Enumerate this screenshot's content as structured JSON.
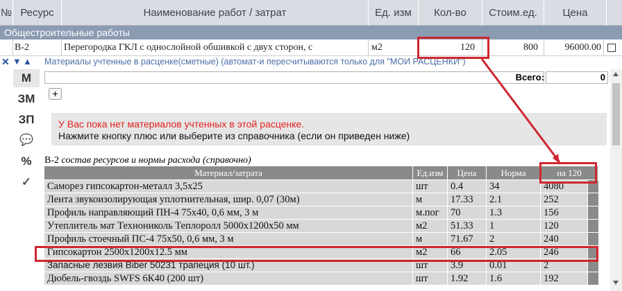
{
  "header": {
    "num": "№",
    "resource": "Ресурс",
    "name": "Наименование работ / затрат",
    "unit": "Ед. изм",
    "qty": "Кол-во",
    "unit_price": "Стоим.ед.",
    "price": "Цена"
  },
  "category": "Общестроительные работы",
  "work_row": {
    "resource": "В-2",
    "name": "Перегородка ГКЛ с однослойной обшивкой с двух сторон, с",
    "unit": "м2",
    "qty": "120",
    "unit_price": "800",
    "price": "96000.00"
  },
  "materials_bar": {
    "close": "✕",
    "down": "▼",
    "up": "▲",
    "text": "Материалы учтенные в расценке(сметные) (автомат-и пересчитываются только для \"МОИ РАСЦЕНКИ\")"
  },
  "sidebar": {
    "m": "М",
    "zm": "ЗМ",
    "zp": "ЗП",
    "comment_icon": "💬",
    "percent": "%",
    "check": "✓"
  },
  "totals": {
    "label": "Всего:",
    "value": "0"
  },
  "add_button": "+",
  "notice": {
    "red_line": "У Вас пока нет материалов учтенных в этой расценке.",
    "black_line": "Нажмите кнопку плюс или выберите из справочника (если он приведен ниже)"
  },
  "reference": {
    "code": "В-2",
    "title": "состав ресурсов и нормы расхода (справочно)",
    "columns": [
      "Материал/затрата",
      "Ед.изм",
      "Цена",
      "Норма",
      "на 120"
    ],
    "rows": [
      [
        "Саморез гипсокартон-металл 3,5х25",
        "шт",
        "0.4",
        "34",
        "4080"
      ],
      [
        "Лента звукоизолирующая уплотнительная, шир. 0,07 (30м)",
        "м",
        "17.33",
        "2.1",
        "252"
      ],
      [
        "Профиль направляющий ПН-4 75х40, 0,6 мм, 3 м",
        "м.пог",
        "70",
        "1.3",
        "156"
      ],
      [
        "Утеплитель мат Технониколь Теплоролл 5000х1200х50 мм",
        "м2",
        "51.33",
        "1",
        "120"
      ],
      [
        "Профиль стоечный ПС-4 75х50, 0,6 мм, 3 м",
        "м",
        "71.67",
        "2",
        "240"
      ],
      [
        "Гипсокартон 2500х1200х12.5 мм",
        "м2",
        "66",
        "2.05",
        "246"
      ],
      [
        "Запасные лезвия Biber 50231 трапеция (10 шт.)",
        "шт",
        "3.9",
        "0.01",
        "2"
      ],
      [
        "Дюбель-гвоздь SWFS 6К40 (200 шт)",
        "шт",
        "1.92",
        "1.6",
        "192"
      ]
    ]
  },
  "colors": {
    "header_bg": "#d9dde3",
    "category_bg": "#8a9bb2",
    "table_header_bg": "#8a8a8a",
    "table_row_bg": "#d8d8d8",
    "highlight_red": "#d0262e"
  }
}
